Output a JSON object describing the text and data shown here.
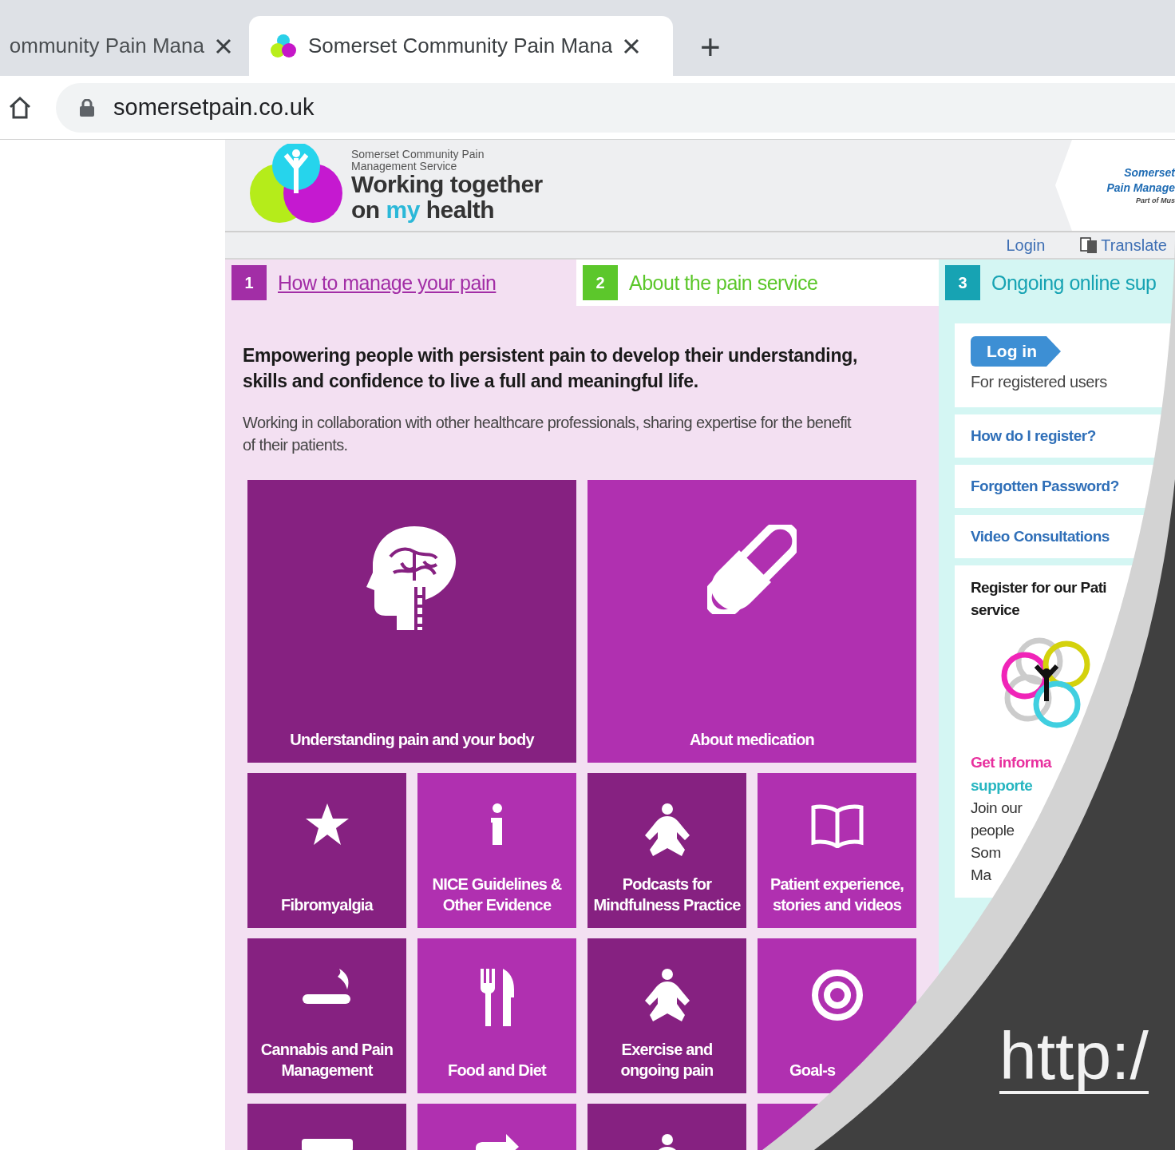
{
  "browser": {
    "tabs": [
      {
        "title": "ommunity Pain Mana",
        "selected": false
      },
      {
        "title": "Somerset Community Pain Mana",
        "selected": true
      }
    ],
    "new_tab": "+",
    "url": "somersetpain.co.uk"
  },
  "header": {
    "logo": {
      "small": "Somerset Community Pain Management Service",
      "line1": "Working together",
      "line2": "on **my** health"
    },
    "partner": [
      "Somerset",
      "Pain Manage",
      "Part of Mus"
    ]
  },
  "utility_links": [
    "Login",
    "Translate"
  ],
  "sections": [
    {
      "number": "1",
      "label": "How to manage your pain",
      "color": "#a22ea6",
      "selected": true
    },
    {
      "number": "2",
      "label": "About the pain service",
      "color": "#5cc72b",
      "selected": false
    },
    {
      "number": "3",
      "label": "Ongoing online sup",
      "color": "#17a3b3",
      "selected": false
    }
  ],
  "intro": {
    "heading": "Empowering people with persistent pain to develop their understanding, skills and confidence to live a full and meaningful life.",
    "text": "Working in collaboration with other healthcare professionals, sharing expertise for the benefit of their patients."
  },
  "tiles": [
    {
      "label": "Understanding pain and your body",
      "kind": "large",
      "color": "#862181"
    },
    {
      "label": "About medication",
      "kind": "large",
      "color": "#b030b0"
    },
    {
      "label": "Fibromyalgia",
      "kind": "small",
      "color": "#862181"
    },
    {
      "label": "NICE Guidelines & Other Evidence",
      "kind": "small",
      "color": "#b030b0"
    },
    {
      "label": "Podcasts for Mindfulness Practice",
      "kind": "small",
      "color": "#862181"
    },
    {
      "label": "Patient experience, stories and videos",
      "kind": "small",
      "color": "#b030b0"
    },
    {
      "label": "Cannabis and Pain Management",
      "kind": "small",
      "color": "#862181"
    },
    {
      "label": "Food and Diet",
      "kind": "small",
      "color": "#b030b0"
    },
    {
      "label": "Exercise and ongoing pain",
      "kind": "small",
      "color": "#862181"
    },
    {
      "label": "Goal-s",
      "kind": "cut",
      "color": "#b030b0"
    },
    {
      "kind": "small",
      "color": "#862181"
    },
    {
      "kind": "small",
      "color": "#b030b0"
    },
    {
      "kind": "small",
      "color": "#862181"
    },
    {
      "kind": "small",
      "color": "#b030b0"
    }
  ],
  "sidebar": {
    "login_button": "Log in",
    "login_note": "For registered users",
    "links": [
      "How do I register?",
      "Forgotten Password?",
      "Video Consultations"
    ],
    "register": {
      "heading": [
        "Register for our Pati",
        "service"
      ],
      "lead": [
        {
          "text": "Get informa",
          "color": "#e8309e"
        },
        {
          "text": "supporte",
          "color": "#26b5c0"
        }
      ],
      "body": [
        "Join our",
        "people",
        "Som",
        "Ma"
      ]
    }
  },
  "overlay": {
    "text": "http:/"
  }
}
